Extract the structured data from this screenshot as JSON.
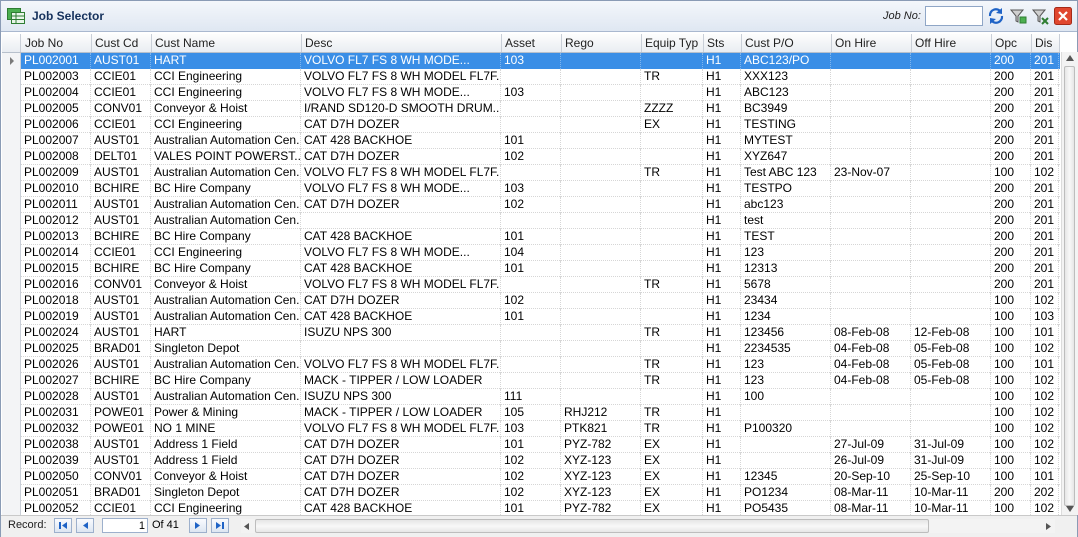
{
  "window": {
    "title": "Job Selector",
    "job_no_label": "Job No:",
    "job_no_value": "",
    "icons": [
      "app-grid-icon",
      "refresh-icon",
      "filter-icon",
      "clear-filter-icon",
      "close-icon"
    ]
  },
  "columns": [
    "Job No",
    "Cust Cd",
    "Cust Name",
    "Desc",
    "Asset",
    "Rego",
    "Equip Typ",
    "Sts",
    "Cust P/O",
    "On Hire",
    "Off Hire",
    "Opc",
    "Dis"
  ],
  "rows": [
    [
      "PL002001",
      "AUST01",
      "HART",
      "VOLVO FL7 FS 8 WH          MODE...",
      "103",
      "",
      "",
      "H1",
      "ABC123/PO",
      "",
      "",
      "200",
      "201"
    ],
    [
      "PL002003",
      "CCIE01",
      "CCI Engineering",
      "VOLVO FL7 FS 8 WH MODEL FL7F...",
      "",
      "",
      "TR",
      "H1",
      "XXX123",
      "",
      "",
      "200",
      "201"
    ],
    [
      "PL002004",
      "CCIE01",
      "CCI Engineering",
      "VOLVO FL7 FS 8 WH          MODE...",
      "103",
      "",
      "",
      "H1",
      "ABC123",
      "",
      "",
      "200",
      "201"
    ],
    [
      "PL002005",
      "CONV01",
      "Conveyor & Hoist",
      "I/RAND  SD120-D SMOOTH DRUM...",
      "",
      "",
      "ZZZZ",
      "H1",
      "BC3949",
      "",
      "",
      "200",
      "201"
    ],
    [
      "PL002006",
      "CCIE01",
      "CCI Engineering",
      "CAT D7H DOZER",
      "",
      "",
      "EX",
      "H1",
      "TESTING",
      "",
      "",
      "200",
      "201"
    ],
    [
      "PL002007",
      "AUST01",
      "Australian Automation Cen...",
      "CAT 428 BACKHOE",
      "101",
      "",
      "",
      "H1",
      "MYTEST",
      "",
      "",
      "200",
      "201"
    ],
    [
      "PL002008",
      "DELT01",
      "VALES  POINT  POWERST...",
      "CAT D7H DOZER",
      "102",
      "",
      "",
      "H1",
      "XYZ647",
      "",
      "",
      "200",
      "201"
    ],
    [
      "PL002009",
      "AUST01",
      "Australian Automation Cen...",
      "VOLVO FL7 FS 8 WH MODEL FL7F...",
      "",
      "",
      "TR",
      "H1",
      "Test ABC 123",
      "23-Nov-07",
      "",
      "100",
      "102"
    ],
    [
      "PL002010",
      "BCHIRE",
      "BC Hire Company",
      "VOLVO FL7 FS 8 WH          MODE...",
      "103",
      "",
      "",
      "H1",
      "TESTPO",
      "",
      "",
      "200",
      "201"
    ],
    [
      "PL002011",
      "AUST01",
      "Australian Automation Cen...",
      "CAT D7H DOZER",
      "102",
      "",
      "",
      "H1",
      "abc123",
      "",
      "",
      "200",
      "201"
    ],
    [
      "PL002012",
      "AUST01",
      "Australian Automation Cen...",
      "",
      "",
      "",
      "",
      "H1",
      "test",
      "",
      "",
      "200",
      "201"
    ],
    [
      "PL002013",
      "BCHIRE",
      "BC Hire Company",
      "CAT 428 BACKHOE",
      "101",
      "",
      "",
      "H1",
      "TEST",
      "",
      "",
      "200",
      "201"
    ],
    [
      "PL002014",
      "CCIE01",
      "CCI Engineering",
      "VOLVO FL7 FS 8 WH          MODE...",
      "104",
      "",
      "",
      "H1",
      "123",
      "",
      "",
      "200",
      "201"
    ],
    [
      "PL002015",
      "BCHIRE",
      "BC Hire Company",
      "CAT 428 BACKHOE",
      "101",
      "",
      "",
      "H1",
      "12313",
      "",
      "",
      "200",
      "201"
    ],
    [
      "PL002016",
      "CONV01",
      "Conveyor & Hoist",
      "VOLVO FL7 FS 8 WH MODEL FL7F...",
      "",
      "",
      "TR",
      "H1",
      "5678",
      "",
      "",
      "200",
      "201"
    ],
    [
      "PL002018",
      "AUST01",
      "Australian Automation Cen...",
      "CAT D7H DOZER",
      "102",
      "",
      "",
      "H1",
      "23434",
      "",
      "",
      "100",
      "102"
    ],
    [
      "PL002019",
      "AUST01",
      "Australian Automation Cen...",
      "CAT 428 BACKHOE",
      "101",
      "",
      "",
      "H1",
      "1234",
      "",
      "",
      "100",
      "103"
    ],
    [
      "PL002024",
      "AUST01",
      "HART",
      "ISUZU NPS 300",
      "",
      "",
      "TR",
      "H1",
      "123456",
      "08-Feb-08",
      "12-Feb-08",
      "100",
      "101"
    ],
    [
      "PL002025",
      "BRAD01",
      "Singleton Depot",
      "",
      "",
      "",
      "",
      "H1",
      "2234535",
      "04-Feb-08",
      "05-Feb-08",
      "100",
      "102"
    ],
    [
      "PL002026",
      "AUST01",
      "Australian Automation Cen...",
      "VOLVO FL7 FS 8 WH MODEL FL7F...",
      "",
      "",
      "TR",
      "H1",
      "123",
      "04-Feb-08",
      "05-Feb-08",
      "100",
      "101"
    ],
    [
      "PL002027",
      "BCHIRE",
      "BC Hire Company",
      "MACK - TIPPER / LOW LOADER",
      "",
      "",
      "TR",
      "H1",
      "123",
      "04-Feb-08",
      "05-Feb-08",
      "100",
      "102"
    ],
    [
      "PL002028",
      "AUST01",
      "Australian Automation Cen...",
      "ISUZU NPS 300",
      "111",
      "",
      "",
      "H1",
      "100",
      "",
      "",
      "100",
      "102"
    ],
    [
      "PL002031",
      "POWE01",
      "Power & Mining",
      "MACK - TIPPER / LOW LOADER",
      "105",
      "RHJ212",
      "TR",
      "H1",
      "",
      "",
      "",
      "100",
      "102"
    ],
    [
      "PL002032",
      "POWE01",
      "NO 1 MINE",
      "VOLVO FL7 FS 8 WH MODEL FL7F...",
      "103",
      "PTK821",
      "TR",
      "H1",
      "P100320",
      "",
      "",
      "100",
      "102"
    ],
    [
      "PL002038",
      "AUST01",
      "Address 1 Field",
      "CAT D7H DOZER",
      "101",
      "PYZ-782",
      "EX",
      "H1",
      "",
      "27-Jul-09",
      "31-Jul-09",
      "100",
      "102"
    ],
    [
      "PL002039",
      "AUST01",
      "Address 1 Field",
      "CAT D7H DOZER",
      "102",
      "XYZ-123",
      "EX",
      "H1",
      "",
      "26-Jul-09",
      "31-Jul-09",
      "100",
      "102"
    ],
    [
      "PL002050",
      "CONV01",
      "Conveyor & Hoist",
      "CAT D7H DOZER",
      "102",
      "XYZ-123",
      "EX",
      "H1",
      "12345",
      "20-Sep-10",
      "25-Sep-10",
      "100",
      "101"
    ],
    [
      "PL002051",
      "BRAD01",
      "Singleton Depot",
      "CAT D7H DOZER",
      "102",
      "XYZ-123",
      "EX",
      "H1",
      "PO1234",
      "08-Mar-11",
      "10-Mar-11",
      "200",
      "202"
    ],
    [
      "PL002052",
      "CCIE01",
      "CCI Engineering",
      "CAT 428 BACKHOE",
      "101",
      "PYZ-782",
      "EX",
      "H1",
      "PO5435",
      "08-Mar-11",
      "10-Mar-11",
      "100",
      "102"
    ]
  ],
  "selected_row": 0,
  "footer": {
    "record_label": "Record:",
    "current_record": "1",
    "of_label": "Of  41"
  },
  "colors": {
    "selection": "#3a8ee6",
    "title_text": "#15315c",
    "close_button": "#e0472f"
  }
}
